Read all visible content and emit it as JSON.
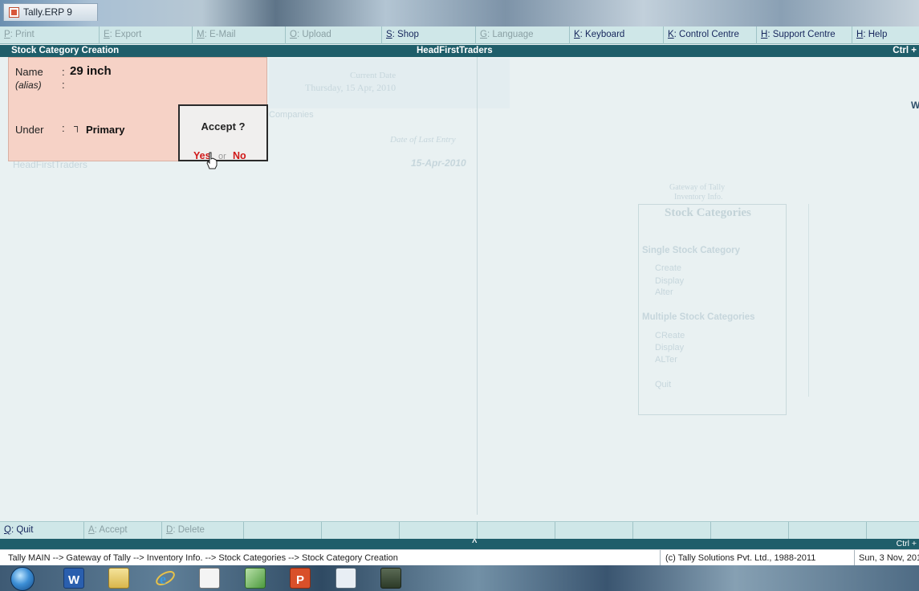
{
  "window": {
    "title": "Tally.ERP 9"
  },
  "top_buttons": [
    {
      "key": "P",
      "label": ": Print",
      "enabled": false
    },
    {
      "key": "E",
      "label": ": Export",
      "enabled": false
    },
    {
      "key": "M",
      "label": ": E-Mail",
      "enabled": false
    },
    {
      "key": "O",
      "label": ": Upload",
      "enabled": false
    },
    {
      "key": "S",
      "label": ": Shop",
      "enabled": true
    },
    {
      "key": "G",
      "label": ": Language",
      "enabled": false
    },
    {
      "key": "K",
      "label": ": Keyboard",
      "enabled": true
    },
    {
      "key": "K",
      "label": ": Control Centre",
      "enabled": true
    },
    {
      "key": "H",
      "label": ": Support Centre",
      "enabled": true
    },
    {
      "key": "H",
      "label": ": Help",
      "enabled": true
    }
  ],
  "header": {
    "screen_title": "Stock Category Creation",
    "company": "HeadFirstTraders",
    "right": "Ctrl +"
  },
  "form": {
    "name_label": "Name",
    "name_sep": ":",
    "name_value": "29 inch",
    "alias_label": "(alias)",
    "alias_sep": ":",
    "under_label": "Under",
    "under_sep": ":",
    "under_mark": "┐",
    "under_value": "Primary"
  },
  "accept_dialog": {
    "question": "Accept ?",
    "yes": "Yes",
    "or": "or",
    "no": "No"
  },
  "background": {
    "current_date_label": "Current Date",
    "current_date_value": "Thursday, 15 Apr, 2010",
    "company_col_label": "Companies",
    "last_entry_label": "Date of Last Entry",
    "last_entry_value": "15-Apr-2010",
    "company_name": "HeadFirstTraders",
    "gateway_line1": "Gateway of Tally",
    "gateway_line2": "Inventory Info.",
    "menu_title": "Stock Categories",
    "single_heading": "Single Stock Category",
    "single_items": [
      "Create",
      "Display",
      "Alter"
    ],
    "multiple_heading": "Multiple Stock Categories",
    "multiple_items": [
      "CReate",
      "Display",
      "ALTer"
    ],
    "quit_item": "Quit",
    "right_edge_letter": "W"
  },
  "bottom_buttons": [
    {
      "key": "Q",
      "label": ": Quit",
      "enabled": true
    },
    {
      "key": "A",
      "label": ": Accept",
      "enabled": false
    },
    {
      "key": "D",
      "label": ": Delete",
      "enabled": false
    }
  ],
  "scroll_strip": {
    "caret": "^",
    "right": "Ctrl +"
  },
  "status": {
    "path": "Tally MAIN --> Gateway of Tally --> Inventory Info. --> Stock Categories --> Stock Category Creation",
    "copyright": "(c) Tally Solutions Pvt. Ltd., 1988-2011",
    "date": "Sun, 3 Nov, 201"
  },
  "taskbar": {
    "icons": [
      "start-orb-icon",
      "word-icon",
      "folder-icon",
      "internet-explorer-icon",
      "tally-icon",
      "green-app-icon",
      "powerpoint-icon",
      "document-icon",
      "media-icon"
    ]
  }
}
